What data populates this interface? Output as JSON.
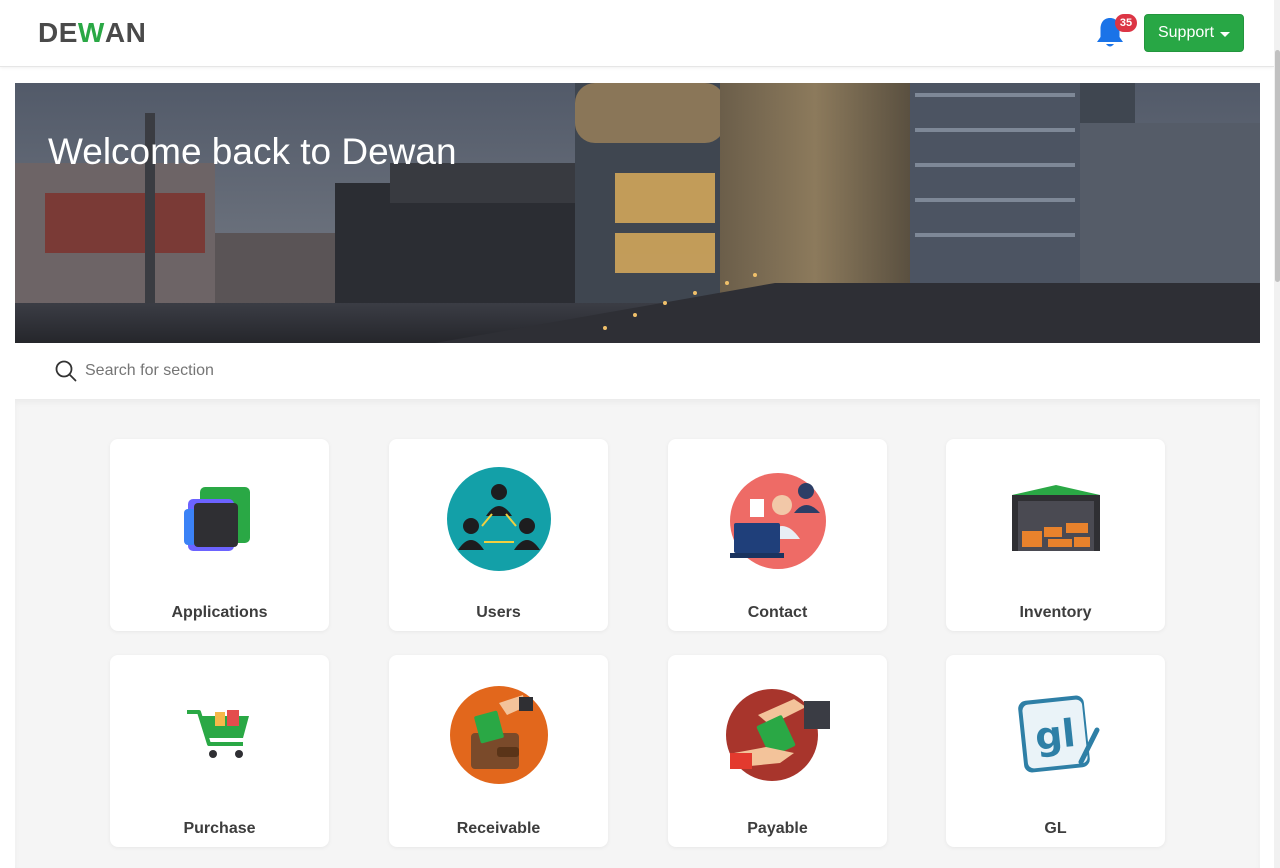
{
  "header": {
    "logo_prefix": "DE",
    "logo_accent": "W",
    "logo_suffix": "AN",
    "notification_count": "35",
    "support_label": "Support"
  },
  "hero": {
    "title": "Welcome back to Dewan"
  },
  "search": {
    "placeholder": "Search for section"
  },
  "sections": [
    {
      "label": "Applications",
      "icon": "applications-icon"
    },
    {
      "label": "Users",
      "icon": "users-icon"
    },
    {
      "label": "Contact",
      "icon": "contact-icon"
    },
    {
      "label": "Inventory",
      "icon": "inventory-icon"
    },
    {
      "label": "Purchase",
      "icon": "purchase-icon"
    },
    {
      "label": "Receivable",
      "icon": "receivable-icon"
    },
    {
      "label": "Payable",
      "icon": "payable-icon"
    },
    {
      "label": "GL",
      "icon": "gl-icon"
    }
  ],
  "colors": {
    "brand_green": "#28a745",
    "badge_red": "#dc3545",
    "bell_blue": "#1a73e8"
  }
}
